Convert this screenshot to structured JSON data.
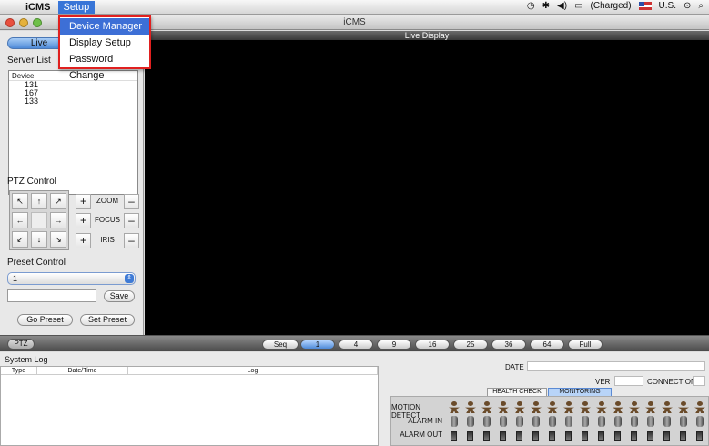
{
  "menubar": {
    "apple": "",
    "app_name": "iCMS",
    "menu_setup": "Setup",
    "status": {
      "time_icon": "clock",
      "charged": "(Charged)",
      "locale": "U.S."
    }
  },
  "setup_menu": {
    "items": [
      "Device Manager",
      "Display Setup",
      "Password Change"
    ]
  },
  "window": {
    "title": "iCMS"
  },
  "left": {
    "live_tab": "Live",
    "server_list_label": "Server List",
    "server_list_header": "Device",
    "servers": [
      "131",
      "167",
      "133"
    ],
    "ptz_label": "PTZ Control",
    "pad": {
      "up_left": "↖",
      "up": "↑",
      "up_right": "↗",
      "left": "←",
      "right": "→",
      "down_left": "↙",
      "down": "↓",
      "down_right": "↘"
    },
    "zoom": "ZOOM",
    "focus": "FOCUS",
    "iris": "IRIS",
    "plus": "+",
    "minus": "–",
    "preset_label": "Preset Control",
    "preset_value": "1",
    "preset_input": "",
    "save": "Save",
    "go_preset": "Go Preset",
    "set_preset": "Set Preset"
  },
  "display": {
    "header": "Live Display"
  },
  "toolbar": {
    "ptz": "PTZ",
    "splits": [
      "Seq",
      "1",
      "4",
      "9",
      "16",
      "25",
      "36",
      "64",
      "Full"
    ],
    "active_split": "1"
  },
  "bottom": {
    "system_log": "System Log",
    "columns": [
      "Type",
      "Date/Time",
      "Log"
    ],
    "date_label": "DATE",
    "ver_label": "VER",
    "connections_label": "CONNECTIONS",
    "tabs": [
      "HEALTH CHECK",
      "MONITORING"
    ],
    "active_tab": "MONITORING",
    "rows": [
      "MOTION DETECT",
      "ALARM IN",
      "ALARM OUT"
    ]
  }
}
